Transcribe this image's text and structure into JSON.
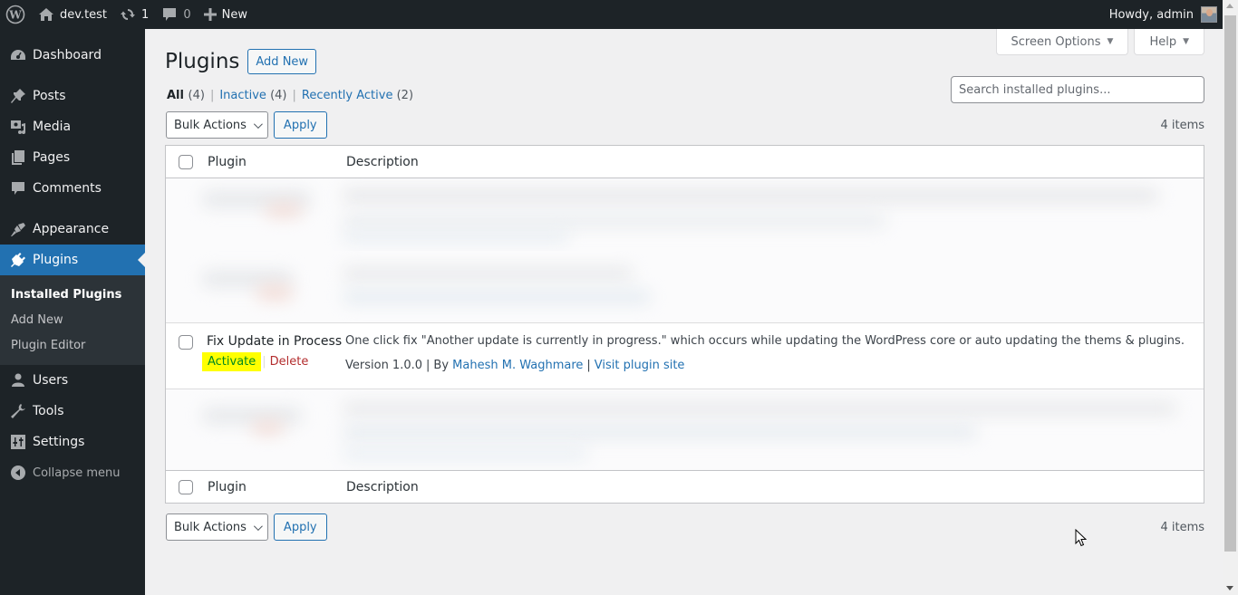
{
  "adminbar": {
    "logo_icon": "wordpress-logo-icon",
    "site_name": "dev.test",
    "site_icon": "home-icon",
    "updates_icon": "updates-icon",
    "updates_count": "1",
    "comments_icon": "comment-bubble-icon",
    "comments_count": "0",
    "new_icon": "plus-icon",
    "new_label": "New",
    "greeting": "Howdy, admin",
    "avatar_icon": "user-avatar"
  },
  "sidebar": {
    "items": [
      {
        "label": "Dashboard",
        "icon": "dashboard-icon"
      },
      {
        "label": "Posts",
        "icon": "pin-icon"
      },
      {
        "label": "Media",
        "icon": "media-icon"
      },
      {
        "label": "Pages",
        "icon": "pages-icon"
      },
      {
        "label": "Comments",
        "icon": "comment-icon"
      },
      {
        "label": "Appearance",
        "icon": "paintbrush-icon"
      },
      {
        "label": "Plugins",
        "icon": "plugin-icon",
        "active": true
      },
      {
        "label": "Users",
        "icon": "users-icon"
      },
      {
        "label": "Tools",
        "icon": "wrench-icon"
      },
      {
        "label": "Settings",
        "icon": "settings-icon"
      }
    ],
    "submenu": [
      {
        "label": "Installed Plugins",
        "current": true
      },
      {
        "label": "Add New"
      },
      {
        "label": "Plugin Editor"
      }
    ],
    "collapse_label": "Collapse menu"
  },
  "screen_meta": {
    "screen_options": "Screen Options",
    "help": "Help"
  },
  "page": {
    "title": "Plugins",
    "add_new": "Add New",
    "filters": [
      {
        "label": "All",
        "count": "(4)",
        "current": true
      },
      {
        "label": "Inactive",
        "count": "(4)"
      },
      {
        "label": "Recently Active",
        "count": "(2)"
      }
    ],
    "search_placeholder": "Search installed plugins...",
    "bulk_actions": "Bulk Actions",
    "apply": "Apply",
    "items_count": "4 items"
  },
  "table": {
    "columns": [
      "Plugin",
      "Description"
    ],
    "rows": [
      {
        "redacted": true
      },
      {
        "redacted": true
      },
      {
        "name": "Fix Update in Process",
        "actions": [
          "Activate",
          "Delete"
        ],
        "description": "One click fix \"Another update is currently in progress.\" which occurs while updating the WordPress core or auto updating the thems & plugins.",
        "version": "Version 1.0.0",
        "by": "By",
        "author": "Mahesh M. Waghmare",
        "visit": "Visit plugin site"
      },
      {
        "redacted": true
      }
    ]
  },
  "colors": {
    "accent": "#2271b1",
    "adminbar_bg": "#1d2327",
    "activate_highlight": "#ffff00",
    "activate_text": "#008a20",
    "delete_text": "#b32d2e"
  }
}
